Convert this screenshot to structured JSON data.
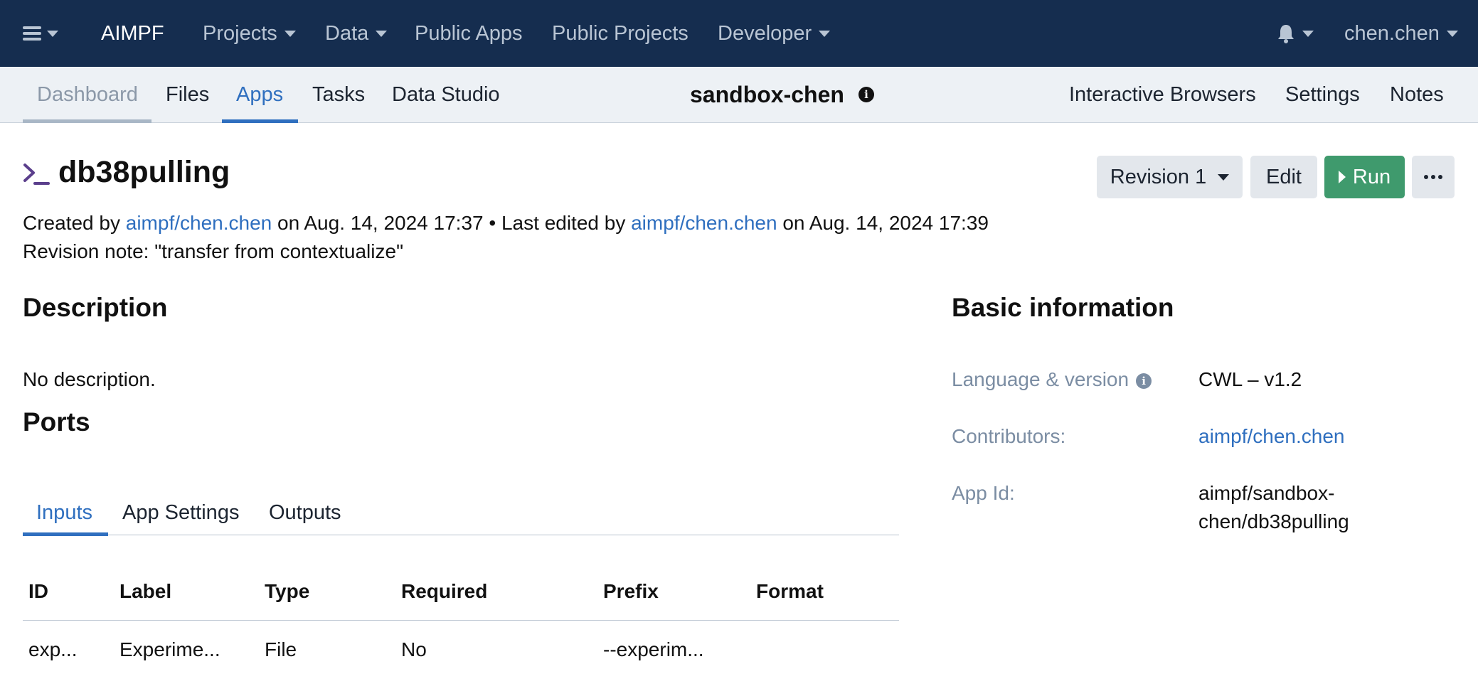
{
  "topbar": {
    "brand": "AIMPF",
    "menu": [
      {
        "label": "Projects",
        "dropdown": true
      },
      {
        "label": "Data",
        "dropdown": true
      },
      {
        "label": "Public Apps",
        "dropdown": false
      },
      {
        "label": "Public Projects",
        "dropdown": false
      },
      {
        "label": "Developer",
        "dropdown": true
      }
    ],
    "user": "chen.chen"
  },
  "subnav": {
    "tabs": [
      "Dashboard",
      "Files",
      "Apps",
      "Tasks",
      "Data Studio"
    ],
    "active_tab": "Apps",
    "project_title": "sandbox-chen",
    "right_links": [
      "Interactive Browsers",
      "Settings",
      "Notes"
    ]
  },
  "app": {
    "title": "db38pulling",
    "created_prefix": "Created by",
    "created_by": "aimpf/chen.chen",
    "created_on": "on Aug. 14, 2024 17:37",
    "separator": "•",
    "edited_prefix": "Last edited by",
    "edited_by": "aimpf/chen.chen",
    "edited_on": "on Aug. 14, 2024 17:39",
    "revision_note": "Revision note: \"transfer from contextualize\""
  },
  "actions": {
    "revision": "Revision 1",
    "edit": "Edit",
    "run": "Run"
  },
  "description": {
    "heading": "Description",
    "text": "No description."
  },
  "ports": {
    "heading": "Ports",
    "tabs": [
      "Inputs",
      "App Settings",
      "Outputs"
    ],
    "active_tab": "Inputs",
    "columns": [
      "ID",
      "Label",
      "Type",
      "Required",
      "Prefix",
      "Format"
    ],
    "rows": [
      [
        "exp...",
        "Experime...",
        "File",
        "No",
        "--experim...",
        ""
      ]
    ]
  },
  "basic_info": {
    "heading": "Basic information",
    "language_label": "Language & version",
    "language_value": "CWL – v1.2",
    "contributors_label": "Contributors:",
    "contributors_value": "aimpf/chen.chen",
    "appid_label": "App Id:",
    "appid_line1": "aimpf/sandbox-",
    "appid_line2": "chen/db38pulling"
  },
  "colors": {
    "navbar": "#152d4f",
    "accent": "#2f6fbf",
    "run_button": "#3f9a6d"
  }
}
